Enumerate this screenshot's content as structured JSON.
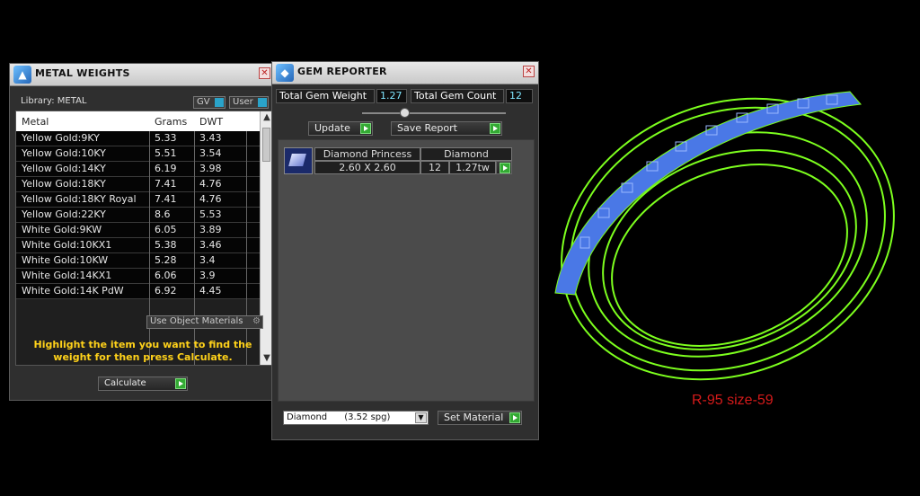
{
  "metal_weights": {
    "title": "METAL WEIGHTS",
    "library_label": "Library: METAL",
    "gv_label": "GV",
    "user_label": "User",
    "columns": [
      "Metal",
      "Grams",
      "DWT"
    ],
    "rows": [
      {
        "metal": "Yellow Gold:9KY",
        "grams": "5.33",
        "dwt": "3.43"
      },
      {
        "metal": "Yellow Gold:10KY",
        "grams": "5.51",
        "dwt": "3.54"
      },
      {
        "metal": "Yellow Gold:14KY",
        "grams": "6.19",
        "dwt": "3.98"
      },
      {
        "metal": "Yellow Gold:18KY",
        "grams": "7.41",
        "dwt": "4.76"
      },
      {
        "metal": "Yellow Gold:18KY Royal",
        "grams": "7.41",
        "dwt": "4.76"
      },
      {
        "metal": "Yellow Gold:22KY",
        "grams": "8.6",
        "dwt": "5.53"
      },
      {
        "metal": "White Gold:9KW",
        "grams": "6.05",
        "dwt": "3.89"
      },
      {
        "metal": "White Gold:10KX1",
        "grams": "5.38",
        "dwt": "3.46"
      },
      {
        "metal": "White Gold:10KW",
        "grams": "5.28",
        "dwt": "3.4"
      },
      {
        "metal": "White Gold:14KX1",
        "grams": "6.06",
        "dwt": "3.9"
      },
      {
        "metal": "White Gold:14K PdW",
        "grams": "6.92",
        "dwt": "4.45"
      }
    ],
    "use_object_materials_label": "Use Object Materials",
    "instruction": "Highlight the item you want to find the weight for then press Calculate.",
    "calculate_label": "Calculate"
  },
  "gem_reporter": {
    "title": "GEM REPORTER",
    "total_weight_label": "Total Gem Weight",
    "total_weight_value": "1.27",
    "total_count_label": "Total Gem Count",
    "total_count_value": "12",
    "update_label": "Update",
    "save_report_label": "Save Report",
    "gem": {
      "shape": "Diamond Princess",
      "material": "Diamond",
      "size": "2.60 X 2.60",
      "count": "12",
      "weight": "1.27tw"
    },
    "material_select": "Diamond      (3.52 spg)",
    "set_material_label": "Set Material"
  },
  "viewport": {
    "caption": "R-95 size-59"
  },
  "colors": {
    "ring": "#7dff1e",
    "gems": "#4a78e6",
    "caption": "#d41a1a",
    "value_text": "#7fe6ff"
  }
}
